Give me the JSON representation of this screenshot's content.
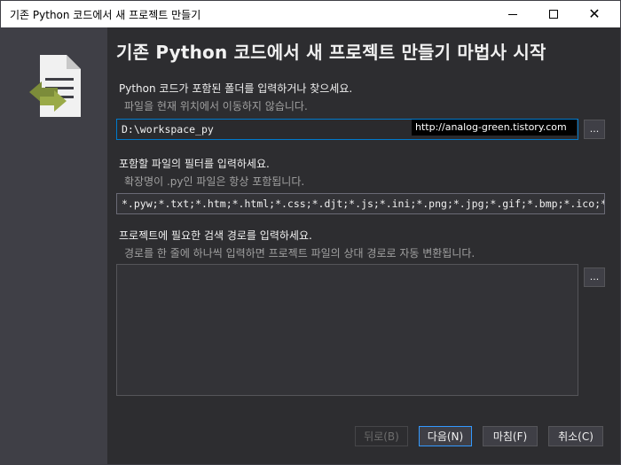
{
  "window": {
    "title": "기존 Python 코드에서 새 프로젝트 만들기"
  },
  "titlebar_buttons": {
    "minimize_icon": "minimize-icon",
    "maximize_icon": "maximize-icon",
    "close_icon": "close-icon",
    "close_glyph": "✕"
  },
  "sidebar": {
    "logo_icon": "wizard-document-icon",
    "accent_color": "#7c8c3a"
  },
  "page": {
    "heading": "기존 Python 코드에서 새 프로젝트 만들기 마법사 시작"
  },
  "folder": {
    "label": "Python 코드가 포함된 폴더를 입력하거나 찾으세요.",
    "sublabel": "파일을 현재 위치에서 이동하지 않습니다.",
    "value": "D:\\workspace_py",
    "browse_label": "...",
    "watermark": "http://analog-green.tistory.com"
  },
  "filter": {
    "label": "포함할 파일의 필터를 입력하세요.",
    "sublabel": "확장명이 .py인 파일은 항상 포함됩니다.",
    "value": "*.pyw;*.txt;*.htm;*.html;*.css;*.djt;*.js;*.ini;*.png;*.jpg;*.gif;*.bmp;*.ico;*.svg"
  },
  "search_paths": {
    "label": "프로젝트에 필요한 검색 경로를 입력하세요.",
    "sublabel": "경로를 한 줄에 하나씩 입력하면 프로젝트 파일의 상대 경로로 자동 변환됩니다.",
    "browse_label": "..."
  },
  "buttons": {
    "back": "뒤로(B)",
    "next": "다음(N)",
    "finish": "마침(F)",
    "cancel": "취소(C)"
  }
}
